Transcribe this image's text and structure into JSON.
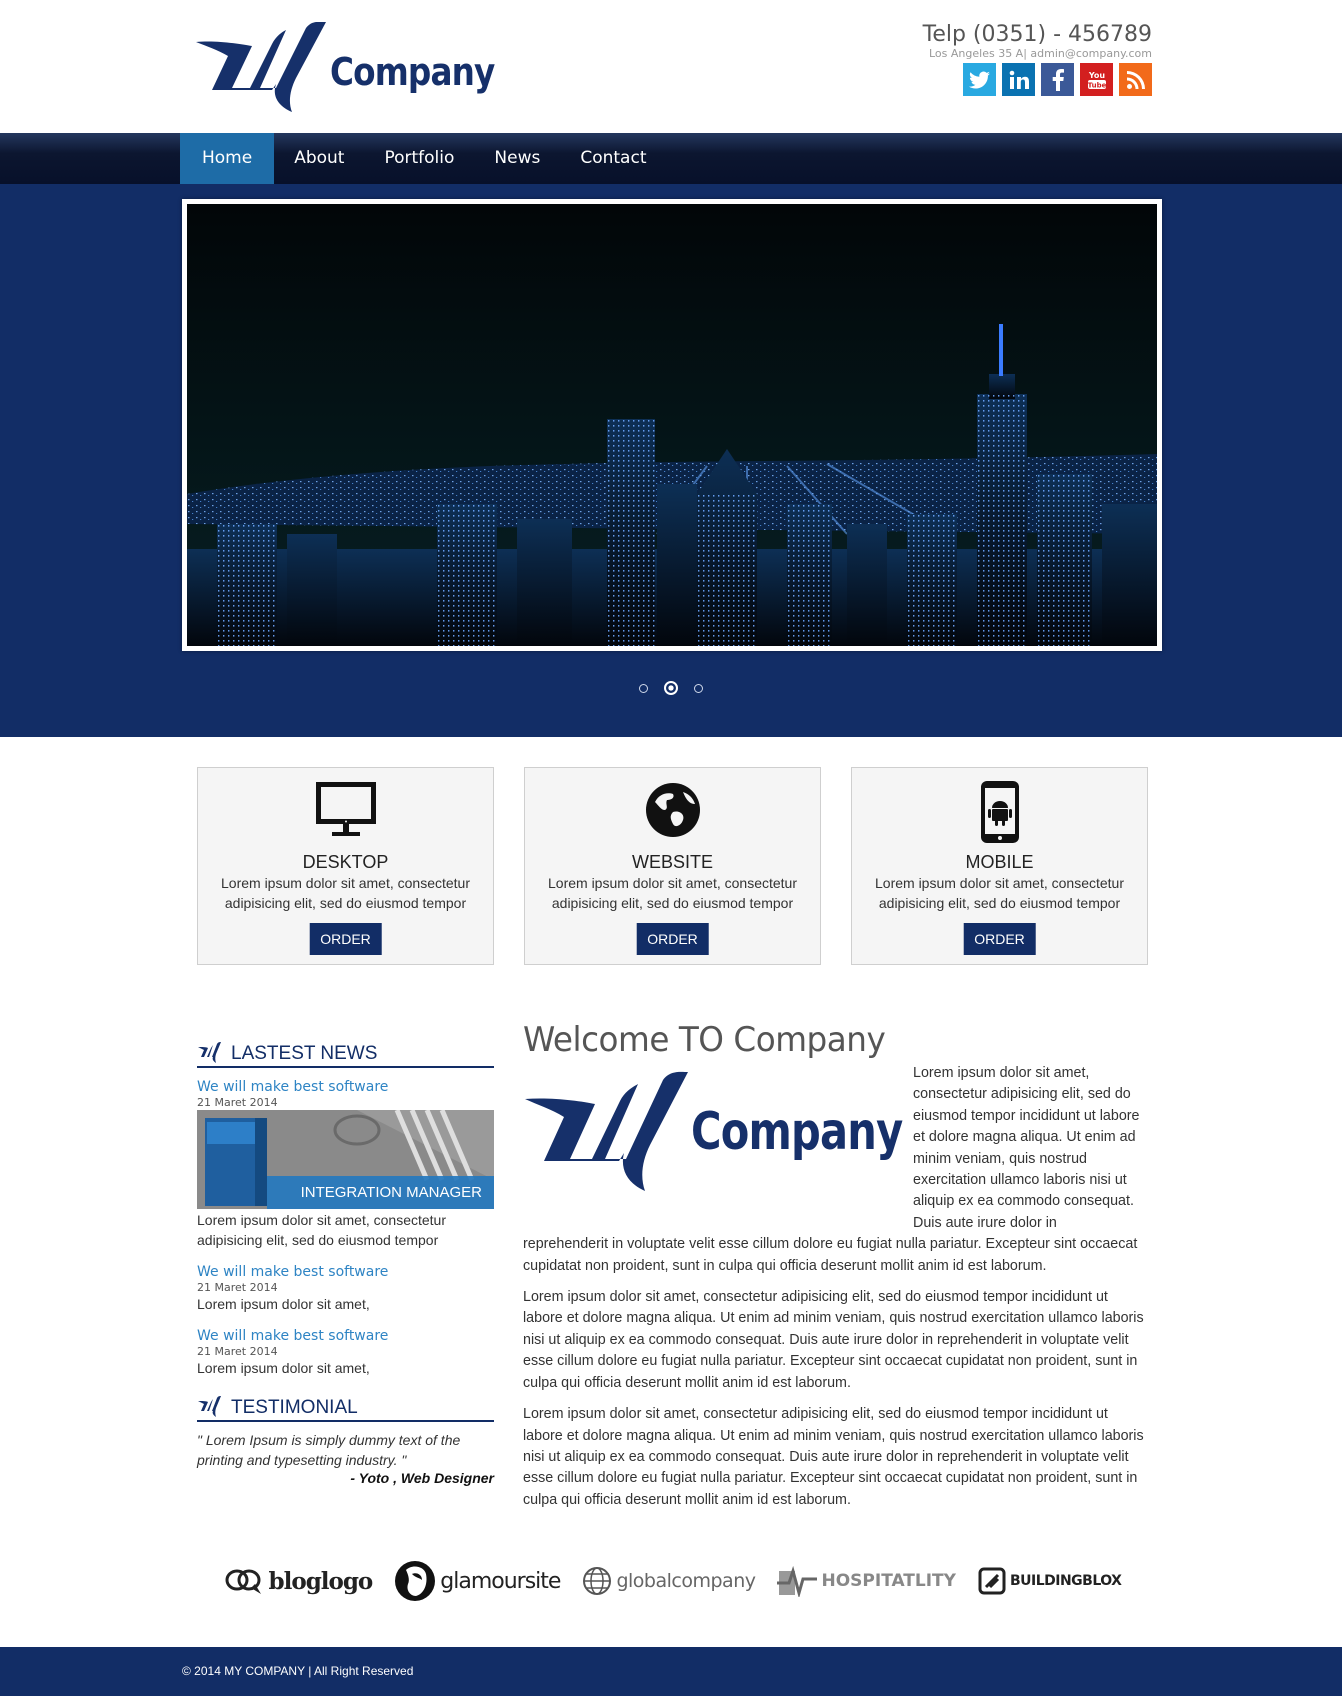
{
  "header": {
    "logo_text": "Company",
    "phone": "Telp (0351) - 456789",
    "address_email": "Los Angeles 35 A| admin@company.com",
    "socials": [
      {
        "name": "twitter",
        "color": "#29a9e1"
      },
      {
        "name": "linkedin",
        "color": "#0a72b1"
      },
      {
        "name": "facebook",
        "color": "#3b5998"
      },
      {
        "name": "youtube",
        "color": "#d31f1f"
      },
      {
        "name": "rss",
        "color": "#f26a1a"
      }
    ]
  },
  "nav": {
    "items": [
      "Home",
      "About",
      "Portfolio",
      "News",
      "Contact"
    ],
    "active": "Home"
  },
  "slider": {
    "slides": 3,
    "active_slide": 2
  },
  "features": [
    {
      "title": "DESKTOP",
      "desc": "Lorem ipsum dolor sit amet, consectetur adipisicing elit, sed do eiusmod tempor",
      "button": "ORDER",
      "icon": "monitor-icon"
    },
    {
      "title": "WEBSITE",
      "desc": "Lorem ipsum dolor sit amet, consectetur adipisicing elit, sed do eiusmod tempor",
      "button": "ORDER",
      "icon": "globe-icon"
    },
    {
      "title": "MOBILE",
      "desc": "Lorem ipsum dolor sit amet, consectetur adipisicing elit, sed do eiusmod tempor",
      "button": "ORDER",
      "icon": "android-phone-icon"
    }
  ],
  "sidebar": {
    "news_heading": "LASTEST NEWS",
    "news": [
      {
        "title": "We will make best software",
        "date": "21 Maret 2014",
        "image_caption": "INTEGRATION MANAGER",
        "text": "Lorem ipsum dolor sit amet, consectetur adipisicing elit, sed do eiusmod tempor"
      },
      {
        "title": "We will make best software",
        "date": "21 Maret 2014",
        "text": "Lorem ipsum dolor sit amet,"
      },
      {
        "title": "We will make best software",
        "date": "21 Maret 2014",
        "text": "Lorem ipsum dolor sit amet,"
      }
    ],
    "testimonial_heading": "TESTIMONIAL",
    "testimonial_quote": "\" Lorem Ipsum is simply dummy text of the printing and typesetting industry. \"",
    "testimonial_author": "- Yoto , Web Designer"
  },
  "main": {
    "heading": "Welcome TO Company",
    "logo_text": "Company",
    "paragraph1": "Lorem ipsum dolor sit amet, consectetur adipisicing elit, sed do eiusmod tempor incididunt ut labore et dolore magna aliqua. Ut enim ad minim veniam, quis nostrud exercitation ullamco laboris nisi ut aliquip ex ea commodo consequat. Duis aute irure dolor in reprehenderit in voluptate velit esse cillum dolore eu fugiat nulla pariatur. Excepteur sint occaecat cupidatat non proident, sunt in culpa qui officia deserunt mollit anim id est laborum.",
    "paragraph2": "Lorem ipsum dolor sit amet, consectetur adipisicing elit, sed do eiusmod tempor incididunt ut labore et dolore magna aliqua. Ut enim ad minim veniam, quis nostrud exercitation ullamco laboris nisi ut aliquip ex ea commodo consequat. Duis aute irure dolor in reprehenderit in voluptate velit esse cillum dolore eu fugiat nulla pariatur. Excepteur sint occaecat cupidatat non proident, sunt in culpa qui officia deserunt mollit anim id est laborum.",
    "paragraph3": "Lorem ipsum dolor sit amet, consectetur adipisicing elit, sed do eiusmod tempor incididunt ut labore et dolore magna aliqua. Ut enim ad minim veniam, quis nostrud exercitation ullamco laboris nisi ut aliquip ex ea commodo consequat. Duis aute irure dolor in reprehenderit in voluptate velit esse cillum dolore eu fugiat nulla pariatur. Excepteur sint occaecat cupidatat non proident, sunt in culpa qui officia deserunt mollit anim id est laborum."
  },
  "brands": [
    "bloglogo",
    "glamoursite",
    "globalcompany",
    "HOSPITATLITY",
    "BUILDINGBLOX"
  ],
  "footer": {
    "copyright": "© 2014 MY COMPANY | All Right Reserved"
  },
  "colors": {
    "brand_navy": "#122d66",
    "nav_active": "#1e6ca7",
    "link_blue": "#2e84c4"
  }
}
